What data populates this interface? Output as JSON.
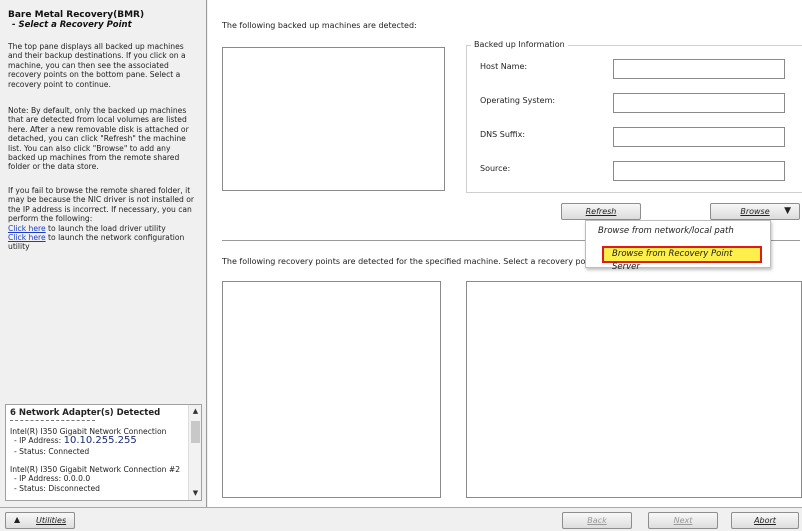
{
  "left": {
    "title": "Bare Metal Recovery(BMR)",
    "subtitle": "- Select a Recovery Point",
    "para1": "The top pane displays all backed up machines and their backup destinations. If you click on a machine, you can then see the associated recovery points on the bottom pane. Select a recovery point to continue.",
    "para2": "Note: By default, only the backed up machines that are detected from local volumes are listed here. After a new removable disk is attached or detached, you can click \"Refresh\" the machine list. You can also click \"Browse\" to add any backed up machines from the remote shared folder or the data store.",
    "para3": "If you fail to browse the remote shared folder, it may be because the NIC driver is not installed or the IP address is incorrect. If necessary, you can perform the following:",
    "link1": "Click here",
    "link1_rest": " to launch the load driver utility",
    "link2": "Click here",
    "link2_rest": " to launch the network configuration utility"
  },
  "network": {
    "title": "6 Network Adapter(s) Detected",
    "adapter1_name": "Intel(R) I350 Gigabit Network Connection",
    "adapter1_ip_label": "- IP Address: ",
    "adapter1_ip": "10.10.255.255",
    "adapter1_status": "- Status: Connected",
    "adapter2_name": "Intel(R) I350 Gigabit Network Connection #2",
    "adapter2_ip": "- IP Address: 0.0.0.0",
    "adapter2_status": "- Status: Disconnected"
  },
  "main": {
    "machines_label": "The following backed up machines are detected:",
    "info_title": "Backed up Information",
    "host_label": "Host Name:",
    "os_label": "Operating System:",
    "dns_label": "DNS Suffix:",
    "source_label": "Source:",
    "refresh_label": "Refresh",
    "browse_label": "Browse",
    "recovery_label": "The following recovery points are detected for the specified machine. Select a recovery point a"
  },
  "dropdown": {
    "item1": "Browse from network/local path",
    "item2": "Browse from Recovery Point Server",
    "highlight_color": "#ffef4a",
    "outline_color": "#e01a1a"
  },
  "bottom": {
    "utilities": "Utilities",
    "back": "Back",
    "next": "Next",
    "abort": "Abort"
  }
}
